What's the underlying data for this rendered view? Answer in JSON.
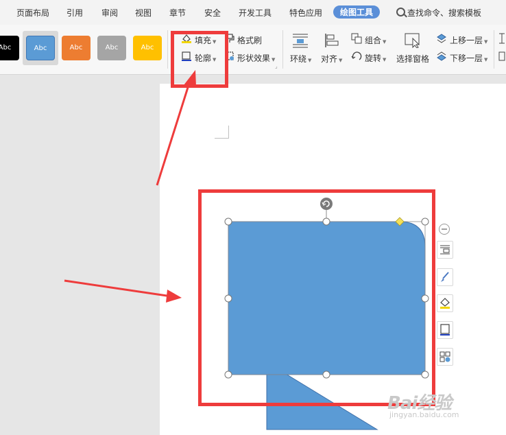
{
  "menu": {
    "items": [
      "页面布局",
      "引用",
      "审阅",
      "视图",
      "章节",
      "安全",
      "开发工具",
      "特色应用"
    ],
    "active_tab": "绘图工具",
    "search_label": "查找命令、搜索模板"
  },
  "ribbon": {
    "style_label": "Abc",
    "style_colors": [
      "#000000",
      "#5b9bd5",
      "#ed7d31",
      "#a5a5a5",
      "#ffc000"
    ],
    "fill_label": "填充",
    "outline_label": "轮廓",
    "format_painter_label": "格式刷",
    "shape_effects_label": "形状效果",
    "wrap_label": "环绕",
    "align_label": "对齐",
    "group_label": "组合",
    "rotate_label": "旋转",
    "selection_pane_label": "选择窗格",
    "bring_forward_label": "上移一层",
    "send_backward_label": "下移一层"
  },
  "canvas": {
    "shape_fill": "#5b9bd5",
    "highlight_color": "#ee3c3c"
  },
  "watermark": {
    "brand": "Bai经验",
    "url": "jingyan.baidu.com"
  }
}
